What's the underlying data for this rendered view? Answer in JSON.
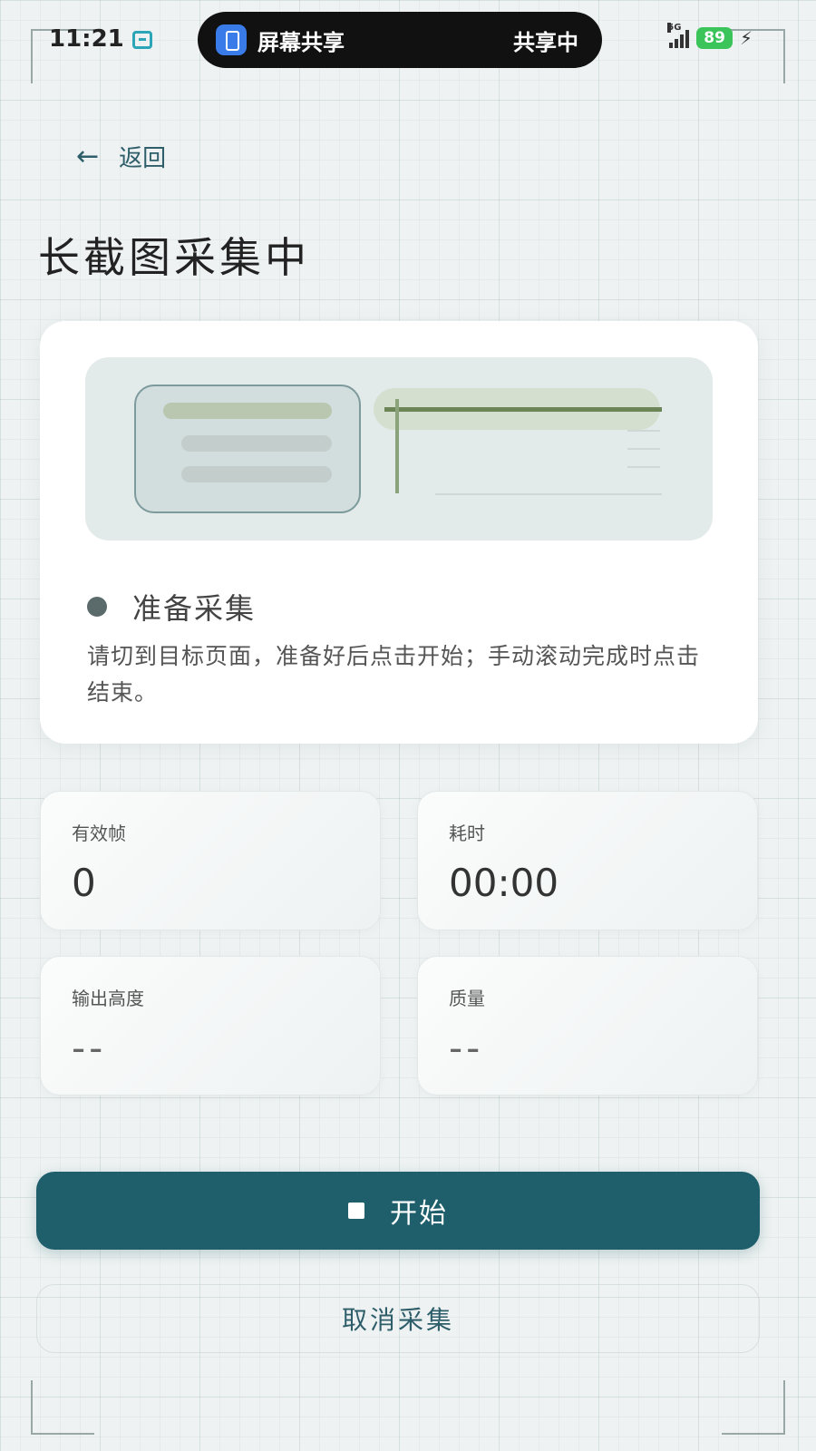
{
  "status_bar": {
    "time": "11:21",
    "share_title": "屏幕共享",
    "share_status": "共享中",
    "network": "5G",
    "battery": "89"
  },
  "header": {
    "back_label": "返回",
    "title": "长截图采集中"
  },
  "capture_card": {
    "status": "准备采集",
    "hint": "请切到目标页面，准备好后点击开始；手动滚动完成时点击结束。"
  },
  "metrics": {
    "valid_frames": {
      "label": "有效帧",
      "value": "0"
    },
    "elapsed": {
      "label": "耗时",
      "value": "00:00"
    },
    "output_height": {
      "label": "输出高度",
      "value": "--"
    },
    "quality": {
      "label": "质量",
      "value": "--"
    }
  },
  "actions": {
    "start_label": "开始",
    "cancel_label": "取消采集"
  },
  "colors": {
    "primary": "#1f5f6c",
    "battery": "#3bc45a",
    "accent_green": "#6b8557"
  }
}
